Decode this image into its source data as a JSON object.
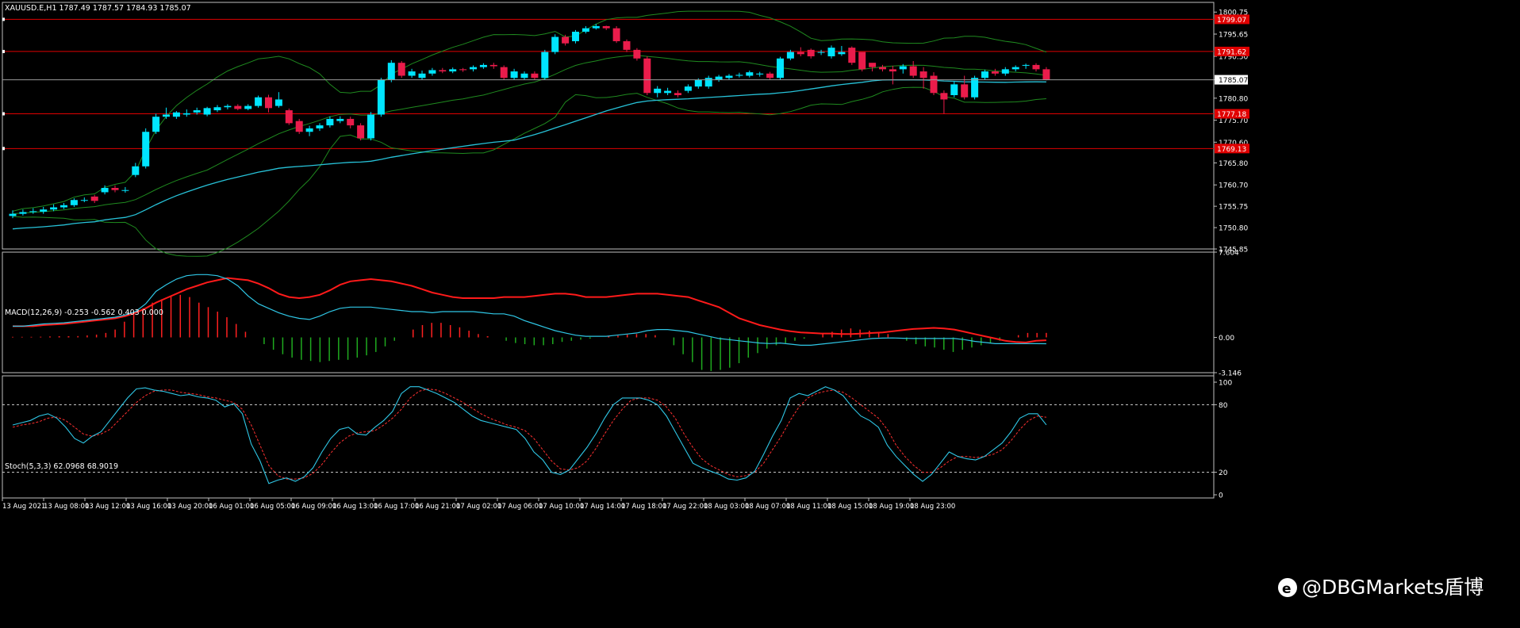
{
  "main": {
    "info": "XAUUSD.E,H1  1787.49 1787.57 1784.93 1785.07",
    "price_labels": [
      "1800.75",
      "1795.65",
      "1790.50",
      "1785.07",
      "1780.80",
      "1775.70",
      "1770.60",
      "1765.80",
      "1760.70",
      "1755.75",
      "1750.80",
      "1745.85"
    ],
    "level_tags": [
      "1799.07",
      "1791.62",
      "1777.18",
      "1769.13"
    ],
    "current_price": "1785.07"
  },
  "macd": {
    "info": "MACD(12,26,9) -0.253 -0.562 0.403 0.000",
    "labels": [
      "7.604",
      "0.00",
      "-3.146"
    ]
  },
  "stoch": {
    "info": "Stoch(5,3,3) 62.0968 68.9019",
    "labels": [
      "100",
      "80",
      "20",
      "0"
    ]
  },
  "time_labels": [
    "13 Aug 2021",
    "13 Aug 08:00",
    "13 Aug 12:00",
    "13 Aug 16:00",
    "13 Aug 20:00",
    "16 Aug 01:00",
    "16 Aug 05:00",
    "16 Aug 09:00",
    "16 Aug 13:00",
    "16 Aug 17:00",
    "16 Aug 21:00",
    "17 Aug 02:00",
    "17 Aug 06:00",
    "17 Aug 10:00",
    "17 Aug 14:00",
    "17 Aug 18:00",
    "17 Aug 22:00",
    "18 Aug 03:00",
    "18 Aug 07:00",
    "18 Aug 11:00",
    "18 Aug 15:00",
    "18 Aug 19:00",
    "18 Aug 23:00"
  ],
  "watermark": "@DBGMarkets盾博",
  "colors": {
    "bull": "#00e5ff",
    "bear": "#ea1c4b",
    "band": "#1f8a1f",
    "ma": "#27c2d8",
    "level": "#e00000",
    "macd_line": "#ff1a1a",
    "signal": "#2fc7e6",
    "hist_pos": "#ff2020",
    "hist_neg": "#1faa1f",
    "stoch_main": "#2fc7e6",
    "stoch_signal": "#ff3030",
    "frame": "#bfbfbf",
    "text": "#ffffff"
  },
  "chart_data": [
    {
      "type": "candlestick",
      "title": "XAUUSD.E,H1",
      "x_start": "13 Aug 2021 04:00",
      "x_interval": "1 hour",
      "ylim": [
        1745.85,
        1803.0
      ],
      "levels": [
        1799.07,
        1791.62,
        1777.18,
        1769.13
      ],
      "open": [
        1753.5,
        1754.0,
        1754.4,
        1754.5,
        1755.0,
        1755.5,
        1756.0,
        1757.2,
        1758.0,
        1759.0,
        1760.0,
        1759.5,
        1763.0,
        1765.0,
        1773.0,
        1776.5,
        1776.5,
        1777.0,
        1777.5,
        1777.0,
        1778.0,
        1778.7,
        1779.0,
        1778.3,
        1779.0,
        1781.0,
        1779.0,
        1778.0,
        1775.5,
        1773.0,
        1773.8,
        1774.5,
        1775.5,
        1776.0,
        1774.5,
        1771.5,
        1777.0,
        1785.0,
        1789.0,
        1786.0,
        1785.5,
        1786.5,
        1787.3,
        1787.0,
        1787.5,
        1787.5,
        1788.0,
        1788.5,
        1788.0,
        1785.5,
        1785.5,
        1786.5,
        1785.5,
        1791.5,
        1795.0,
        1794.0,
        1796.2,
        1797.0,
        1797.5,
        1797.0,
        1794.0,
        1792.0,
        1790.0,
        1782.0,
        1782.0,
        1782.0,
        1782.5,
        1783.5,
        1783.5,
        1785.0,
        1785.5,
        1786.0,
        1786.0,
        1786.3,
        1786.5,
        1785.5,
        1790.0,
        1791.5,
        1792.0,
        1791.5,
        1790.5,
        1791.0,
        1792.5,
        1791.5,
        1789.0,
        1788.0,
        1787.5,
        1787.5,
        1788.2,
        1787.0,
        1786.0,
        1782.0,
        1781.5,
        1784.0,
        1781.0,
        1785.5,
        1787.0,
        1786.5,
        1787.5,
        1788.5,
        1788.5,
        1787.5
      ],
      "close": [
        1754.0,
        1754.4,
        1754.6,
        1755.0,
        1755.5,
        1756.0,
        1757.2,
        1757.2,
        1757.0,
        1760.0,
        1759.5,
        1759.5,
        1765.0,
        1773.0,
        1776.5,
        1777.0,
        1777.5,
        1777.3,
        1778.0,
        1778.5,
        1778.7,
        1779.0,
        1778.3,
        1779.0,
        1781.0,
        1778.5,
        1780.5,
        1775.0,
        1773.0,
        1773.8,
        1774.5,
        1776.0,
        1776.0,
        1774.5,
        1771.5,
        1777.0,
        1785.0,
        1789.0,
        1786.0,
        1787.0,
        1786.5,
        1787.3,
        1787.0,
        1787.5,
        1787.3,
        1788.0,
        1788.5,
        1788.2,
        1785.5,
        1787.0,
        1786.5,
        1785.5,
        1791.5,
        1795.0,
        1793.5,
        1796.2,
        1797.0,
        1797.5,
        1797.0,
        1794.0,
        1792.0,
        1790.0,
        1782.0,
        1783.0,
        1782.5,
        1781.5,
        1783.5,
        1785.0,
        1785.5,
        1785.8,
        1786.0,
        1786.2,
        1786.8,
        1786.5,
        1785.5,
        1790.0,
        1791.5,
        1791.0,
        1790.5,
        1791.5,
        1792.5,
        1791.5,
        1789.0,
        1787.5,
        1788.0,
        1787.5,
        1787.0,
        1788.2,
        1786.0,
        1785.5,
        1782.0,
        1780.5,
        1784.0,
        1781.0,
        1785.5,
        1787.0,
        1786.5,
        1787.5,
        1788.0,
        1788.5,
        1787.5,
        1785.07
      ],
      "high": [
        1754.8,
        1755.0,
        1755.3,
        1755.6,
        1756.2,
        1756.5,
        1757.6,
        1757.8,
        1758.4,
        1760.6,
        1760.6,
        1760.2,
        1765.8,
        1773.8,
        1777.2,
        1778.6,
        1777.8,
        1778.2,
        1778.6,
        1778.8,
        1779.2,
        1779.4,
        1779.4,
        1779.4,
        1781.4,
        1781.6,
        1782.2,
        1778.4,
        1776.0,
        1774.4,
        1775.0,
        1776.6,
        1776.6,
        1776.5,
        1775.0,
        1777.6,
        1785.5,
        1789.6,
        1789.4,
        1787.6,
        1787.2,
        1787.8,
        1787.8,
        1787.9,
        1787.8,
        1788.4,
        1788.9,
        1789.0,
        1788.4,
        1787.6,
        1787.0,
        1787.0,
        1792.0,
        1795.6,
        1795.5,
        1796.6,
        1797.5,
        1798.0,
        1797.6,
        1797.5,
        1794.4,
        1792.4,
        1790.5,
        1783.6,
        1783.2,
        1782.6,
        1784.0,
        1785.4,
        1786.0,
        1786.2,
        1786.4,
        1786.7,
        1787.2,
        1786.9,
        1786.9,
        1790.4,
        1792.0,
        1792.6,
        1792.3,
        1792.0,
        1793.0,
        1792.9,
        1792.8,
        1790.4,
        1788.5,
        1788.5,
        1788.3,
        1788.7,
        1789.4,
        1788.0,
        1786.8,
        1782.6,
        1784.8,
        1786.0,
        1786.0,
        1787.4,
        1787.6,
        1788.0,
        1788.4,
        1788.8,
        1788.9,
        1788.0
      ],
      "low": [
        1753.0,
        1753.6,
        1754.0,
        1754.0,
        1754.6,
        1755.1,
        1755.6,
        1756.7,
        1756.5,
        1758.5,
        1759.0,
        1758.9,
        1762.5,
        1764.5,
        1772.5,
        1776.0,
        1776.0,
        1776.5,
        1777.0,
        1776.6,
        1777.6,
        1778.2,
        1778.0,
        1778.0,
        1778.6,
        1777.5,
        1778.6,
        1774.6,
        1772.5,
        1772.0,
        1773.2,
        1774.0,
        1775.0,
        1773.8,
        1771.0,
        1771.0,
        1776.5,
        1784.5,
        1785.5,
        1785.5,
        1785.0,
        1786.0,
        1786.6,
        1786.6,
        1786.9,
        1787.0,
        1787.6,
        1787.6,
        1785.0,
        1785.0,
        1785.0,
        1785.0,
        1785.0,
        1791.0,
        1793.0,
        1793.5,
        1795.8,
        1796.7,
        1796.6,
        1793.6,
        1791.5,
        1789.5,
        1781.5,
        1781.0,
        1781.5,
        1781.0,
        1782.0,
        1783.0,
        1783.0,
        1784.6,
        1785.0,
        1785.6,
        1785.6,
        1785.8,
        1785.0,
        1785.0,
        1789.6,
        1790.5,
        1790.0,
        1790.8,
        1790.0,
        1790.6,
        1788.5,
        1787.0,
        1787.0,
        1787.0,
        1784.0,
        1786.5,
        1785.5,
        1783.0,
        1781.5,
        1777.18,
        1781.0,
        1780.5,
        1780.5,
        1785.0,
        1786.0,
        1786.0,
        1787.0,
        1787.6,
        1787.0,
        1784.93
      ]
    },
    {
      "type": "line",
      "title": "MACD(12,26,9) -0.253 -0.562 0.403 0.000",
      "ylim": [
        -3.146,
        7.604
      ],
      "series": [
        {
          "name": "MACD",
          "values": [
            1.0,
            1.0,
            1.1,
            1.2,
            1.25,
            1.3,
            1.4,
            1.5,
            1.6,
            1.7,
            1.8,
            2.0,
            2.3,
            3.0,
            4.1,
            4.7,
            5.2,
            5.5,
            5.6,
            5.6,
            5.5,
            5.2,
            4.6,
            3.7,
            3.0,
            2.6,
            2.2,
            1.9,
            1.7,
            1.6,
            1.9,
            2.3,
            2.6,
            2.7,
            2.7,
            2.7,
            2.6,
            2.5,
            2.4,
            2.3,
            2.3,
            2.2,
            2.3,
            2.3,
            2.3,
            2.3,
            2.2,
            2.1,
            2.1,
            1.9,
            1.5,
            1.2,
            0.9,
            0.6,
            0.4,
            0.2,
            0.1,
            0.1,
            0.1,
            0.2,
            0.3,
            0.4,
            0.6,
            0.7,
            0.7,
            0.6,
            0.5,
            0.3,
            0.1,
            -0.1,
            -0.2,
            -0.3,
            -0.4,
            -0.5,
            -0.55,
            -0.5,
            -0.6,
            -0.7,
            -0.7,
            -0.6,
            -0.5,
            -0.4,
            -0.3,
            -0.2,
            -0.1,
            -0.06,
            -0.05,
            -0.08,
            -0.1,
            -0.1,
            -0.1,
            -0.1,
            -0.1,
            -0.2,
            -0.35,
            -0.45,
            -0.56,
            -0.56,
            -0.56,
            -0.56,
            -0.56,
            -0.562
          ]
        },
        {
          "name": "Signal",
          "values": [
            1.0,
            1.0,
            1.0,
            1.1,
            1.15,
            1.2,
            1.3,
            1.4,
            1.5,
            1.6,
            1.7,
            1.9,
            2.2,
            2.6,
            3.1,
            3.5,
            3.9,
            4.3,
            4.6,
            4.9,
            5.1,
            5.3,
            5.2,
            5.1,
            4.8,
            4.4,
            3.9,
            3.6,
            3.5,
            3.6,
            3.8,
            4.2,
            4.7,
            5.0,
            5.1,
            5.2,
            5.1,
            5.0,
            4.8,
            4.6,
            4.3,
            4.0,
            3.8,
            3.6,
            3.5,
            3.5,
            3.5,
            3.5,
            3.6,
            3.6,
            3.6,
            3.7,
            3.8,
            3.9,
            3.9,
            3.8,
            3.6,
            3.6,
            3.6,
            3.7,
            3.8,
            3.9,
            3.9,
            3.9,
            3.8,
            3.7,
            3.6,
            3.3,
            3.0,
            2.7,
            2.2,
            1.7,
            1.4,
            1.1,
            0.9,
            0.7,
            0.55,
            0.45,
            0.4,
            0.35,
            0.35,
            0.3,
            0.3,
            0.35,
            0.4,
            0.45,
            0.55,
            0.65,
            0.75,
            0.8,
            0.85,
            0.8,
            0.7,
            0.5,
            0.3,
            0.1,
            -0.1,
            -0.3,
            -0.4,
            -0.45,
            -0.3,
            -0.253
          ]
        }
      ],
      "histogram": [
        0.05,
        0.05,
        0.05,
        0.06,
        0.08,
        0.1,
        0.1,
        0.12,
        0.18,
        0.25,
        0.4,
        0.7,
        1.4,
        2.1,
        2.6,
        3.1,
        3.4,
        3.7,
        3.8,
        3.6,
        3.1,
        2.7,
        2.3,
        1.8,
        1.2,
        0.5,
        0.0,
        -0.6,
        -1.1,
        -1.5,
        -1.8,
        -2.0,
        -2.1,
        -2.2,
        -2.1,
        -2.0,
        -2.0,
        -1.8,
        -1.6,
        -1.3,
        -0.8,
        -0.3,
        0.0,
        0.7,
        1.1,
        1.3,
        1.3,
        1.1,
        0.9,
        0.6,
        0.3,
        0.1,
        0.0,
        -0.3,
        -0.5,
        -0.6,
        -0.7,
        -0.7,
        -0.6,
        -0.4,
        -0.3,
        -0.2,
        -0.1,
        0.0,
        0.1,
        0.15,
        0.25,
        0.3,
        0.3,
        0.2,
        0.0,
        -0.7,
        -1.5,
        -2.2,
        -2.9,
        -3.0,
        -2.9,
        -2.7,
        -2.3,
        -1.8,
        -1.4,
        -1.0,
        -0.7,
        -0.5,
        -0.3,
        -0.1,
        0.0,
        0.3,
        0.5,
        0.7,
        0.8,
        0.7,
        0.6,
        0.5,
        0.3,
        0.0,
        -0.3,
        -0.6,
        -0.8,
        -0.9,
        -1.1,
        -1.3,
        -1.1,
        -0.9,
        -0.7,
        -0.5,
        -0.3,
        0.0,
        0.2,
        0.4,
        0.4,
        0.403
      ]
    },
    {
      "type": "line",
      "title": "Stoch(5,3,3) 62.0968 68.9019",
      "ylim": [
        0,
        100
      ],
      "levels": [
        80,
        20
      ],
      "series": [
        {
          "name": "Main",
          "values": [
            62,
            64,
            66,
            70,
            72,
            68,
            60,
            50,
            46,
            52,
            56,
            66,
            76,
            86,
            94,
            95,
            93,
            92,
            90,
            88,
            89,
            87,
            86,
            84,
            78,
            81,
            72,
            45,
            30,
            10,
            13,
            15,
            12,
            16,
            24,
            38,
            50,
            58,
            60,
            54,
            53,
            60,
            66,
            74,
            90,
            96,
            96,
            93,
            90,
            86,
            82,
            76,
            70,
            66,
            64,
            62,
            60,
            58,
            50,
            38,
            31,
            20,
            18,
            22,
            32,
            42,
            54,
            68,
            80,
            86,
            86,
            86,
            84,
            80,
            70,
            56,
            42,
            28,
            24,
            21,
            18,
            14,
            13,
            15,
            21,
            36,
            52,
            66,
            86,
            90,
            88,
            92,
            96,
            93,
            88,
            78,
            70,
            66,
            60,
            44,
            34,
            26,
            18,
            12,
            18,
            28,
            38,
            34,
            32,
            31,
            34,
            40,
            46,
            56,
            68,
            72,
            72,
            62.0968
          ]
        },
        {
          "name": "Signal",
          "values": [
            60,
            62,
            63,
            65,
            68,
            69,
            66,
            60,
            54,
            52,
            54,
            58,
            66,
            74,
            82,
            88,
            92,
            93,
            93,
            91,
            90,
            89,
            87,
            86,
            84,
            82,
            76,
            62,
            44,
            26,
            17,
            14,
            14,
            15,
            19,
            27,
            37,
            46,
            52,
            55,
            56,
            57,
            62,
            68,
            76,
            86,
            92,
            94,
            93,
            90,
            86,
            82,
            77,
            72,
            68,
            65,
            62,
            60,
            57,
            50,
            40,
            30,
            23,
            22,
            24,
            30,
            41,
            54,
            66,
            76,
            84,
            86,
            86,
            84,
            78,
            68,
            54,
            42,
            32,
            26,
            22,
            18,
            16,
            17,
            20,
            28,
            40,
            52,
            66,
            78,
            86,
            90,
            92,
            93,
            91,
            86,
            80,
            74,
            68,
            58,
            44,
            34,
            26,
            20,
            20,
            24,
            30,
            34,
            34,
            33,
            34,
            36,
            40,
            48,
            58,
            66,
            70,
            68.9019
          ]
        }
      ]
    }
  ]
}
